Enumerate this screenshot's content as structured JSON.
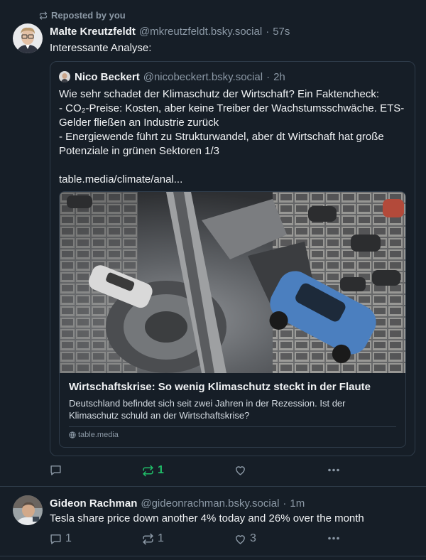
{
  "repost": {
    "label": "Reposted by you"
  },
  "post1": {
    "author_name": "Malte Kreutzfeldt",
    "handle": "@mkreutzfeldt.bsky.social",
    "separator": "·",
    "time": "57s",
    "text": "Interessante Analyse:",
    "quote": {
      "author_name": "Nico Beckert",
      "handle": "@nicobeckert.bsky.social",
      "separator": "·",
      "time": "2h",
      "text": "Wie sehr schadet der Klimaschutz der Wirtschaft? Ein Faktencheck:\n- CO₂-Preise: Kosten, aber keine Treiber der Wachstumsschwäche. ETS-Gelder fließen an Industrie zurück\n- Energiewende führt zu Strukturwandel, aber dt Wirtschaft hat große Potenziale in grünen Sektoren 1/3\n\ntable.media/climate/anal...",
      "link": {
        "title": "Wirtschaftskrise: So wenig Klimaschutz steckt in der Flaute",
        "description": "Deutschland befindet sich seit zwei Jahren in der Rezession. Ist der Klimaschutz schuld an der Wirtschaftskrise?",
        "domain": "table.media"
      }
    },
    "actions": {
      "reply_count": "",
      "repost_count": "1",
      "like_count": ""
    }
  },
  "post2": {
    "author_name": "Gideon Rachman",
    "handle": "@gideonrachman.bsky.social",
    "separator": "·",
    "time": "1m",
    "text": "Tesla share price down another 4% today and 26% over the month",
    "actions": {
      "reply_count": "1",
      "repost_count": "1",
      "like_count": "3"
    }
  },
  "colors": {
    "background": "#161e27",
    "repost_active": "#20bc68",
    "muted": "#8b98a5",
    "border": "#2e3b49"
  },
  "icons": [
    "repost-icon",
    "reply-icon",
    "like-icon",
    "more-icon",
    "globe-icon"
  ]
}
